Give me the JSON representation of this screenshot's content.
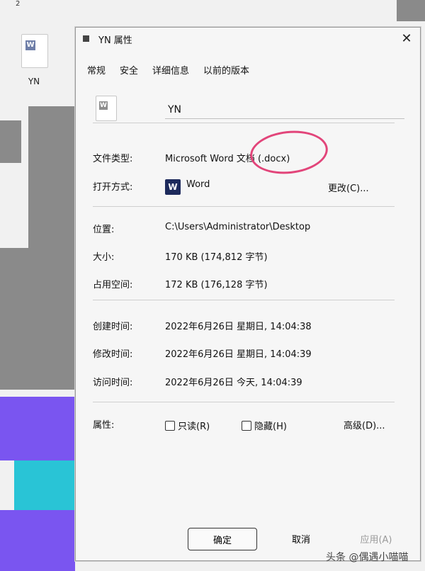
{
  "desktop": {
    "top_crop_text": "2",
    "icon_label": "YN"
  },
  "dialog": {
    "title": "YN 属性",
    "close_glyph": "✕",
    "tabs": [
      "常规",
      "安全",
      "详细信息",
      "以前的版本"
    ],
    "file_name": "YN",
    "file_type": {
      "label": "文件类型:",
      "value": "Microsoft Word 文档 (.docx)"
    },
    "opens_with": {
      "label": "打开方式:",
      "app": "Word",
      "change_button": "更改(C)..."
    },
    "location": {
      "label": "位置:",
      "value": "C:\\Users\\Administrator\\Desktop"
    },
    "size": {
      "label": "大小:",
      "value": "170 KB (174,812 字节)"
    },
    "size_on_disk": {
      "label": "占用空间:",
      "value": "172 KB (176,128 字节)"
    },
    "created": {
      "label": "创建时间:",
      "value": "2022年6月26日 星期日, 14:04:38"
    },
    "modified": {
      "label": "修改时间:",
      "value": "2022年6月26日 星期日, 14:04:39"
    },
    "accessed": {
      "label": "访问时间:",
      "value": "2022年6月26日 今天, 14:04:39"
    },
    "attributes": {
      "label": "属性:",
      "readonly": "只读(R)",
      "hidden": "隐藏(H)",
      "advanced_button": "高级(D)..."
    },
    "buttons": {
      "ok": "确定",
      "cancel": "取消",
      "apply": "应用(A)"
    }
  },
  "watermark": "头条 @偶遇小喵喵",
  "colors": {
    "annotation": "#e2457a",
    "word_icon": "#1d2a5c",
    "wallpaper_purple": "#7a55f0",
    "wallpaper_cyan": "#29c4d6"
  }
}
